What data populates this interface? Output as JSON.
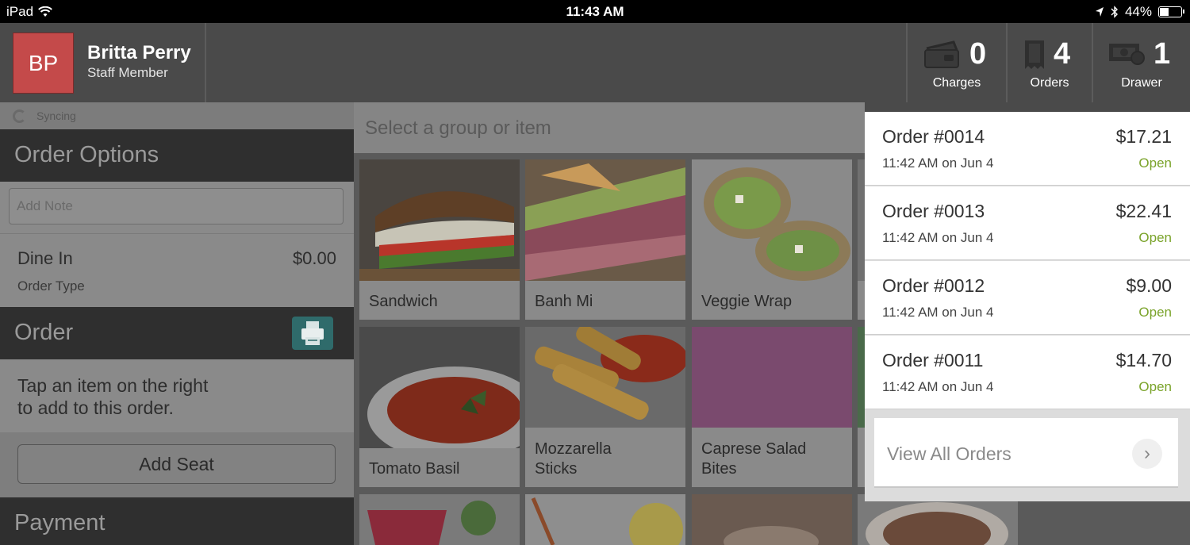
{
  "status_bar": {
    "device": "iPad",
    "time": "11:43 AM",
    "battery": "44%",
    "battery_level": 0.44
  },
  "user": {
    "initials": "BP",
    "name": "Britta Perry",
    "role": "Staff Member"
  },
  "header_buttons": [
    {
      "count": "0",
      "label": "Charges",
      "icon": "card-icon"
    },
    {
      "count": "4",
      "label": "Orders",
      "icon": "receipt-icon"
    },
    {
      "count": "1",
      "label": "Drawer",
      "icon": "cash-drawer-icon"
    }
  ],
  "left_panel": {
    "sync_status": "Syncing",
    "order_options_title": "Order Options",
    "note_placeholder": "Add Note",
    "order_type": {
      "name": "Dine In",
      "price": "$0.00",
      "sublabel": "Order Type"
    },
    "order_title": "Order",
    "order_empty_message_line1": "Tap an item on the right",
    "order_empty_message_line2": "to add to this order.",
    "add_seat_label": "Add Seat",
    "payment_title": "Payment"
  },
  "menu": {
    "search_placeholder": "Select a group or item",
    "items": [
      {
        "name": "Sandwich"
      },
      {
        "name": "Banh Mi"
      },
      {
        "name": "Veggie Wrap"
      },
      {
        "name": "Tomato Basil"
      },
      {
        "name_line1": "Mozzarella",
        "name_line2": "Sticks"
      },
      {
        "name_line1": "Caprese Salad",
        "name_line2": "Bites",
        "color": "#7a4a6e"
      }
    ]
  },
  "orders_popover": {
    "orders": [
      {
        "number": "Order #0014",
        "amount": "$17.21",
        "time": "11:42 AM on Jun 4",
        "status": "Open"
      },
      {
        "number": "Order #0013",
        "amount": "$22.41",
        "time": "11:42 AM on Jun 4",
        "status": "Open"
      },
      {
        "number": "Order #0012",
        "amount": "$9.00",
        "time": "11:42 AM on Jun 4",
        "status": "Open"
      },
      {
        "number": "Order #0011",
        "amount": "$14.70",
        "time": "11:42 AM on Jun 4",
        "status": "Open"
      }
    ],
    "view_all_label": "View All Orders"
  },
  "colors": {
    "avatar": "#c44a4a",
    "open_status": "#7aa32a",
    "print_button": "#2f6b6b"
  }
}
